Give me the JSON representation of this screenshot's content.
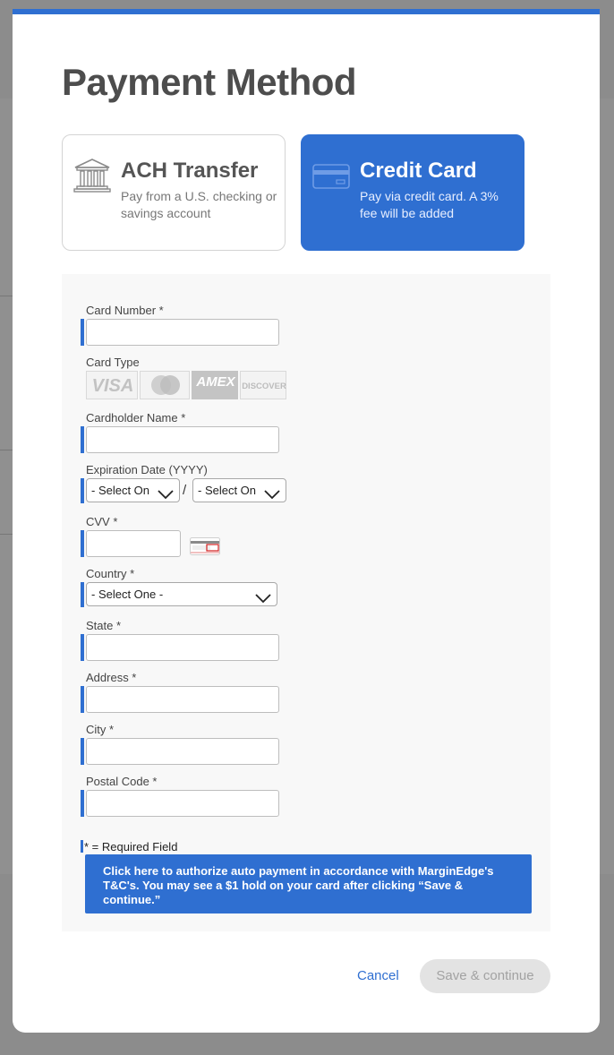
{
  "modal": {
    "title": "Payment Method"
  },
  "methods": {
    "ach": {
      "title": "ACH Transfer",
      "description": "Pay from a U.S. checking or savings account",
      "icon": "bank-icon"
    },
    "credit_card": {
      "title": "Credit Card",
      "description": "Pay via credit card. A 3% fee will be added",
      "icon": "credit-card-icon",
      "selected": true
    }
  },
  "form": {
    "card_number_label": "Card Number *",
    "card_number_value": "",
    "card_type_label": "Card Type",
    "card_types": [
      "VISA",
      "Mastercard",
      "AMEX",
      "DISCOVER"
    ],
    "cardholder_label": "Cardholder Name *",
    "cardholder_value": "",
    "expiration_label": "Expiration Date (YYYY)",
    "exp_month_value": "- Select On",
    "exp_separator": "/",
    "exp_year_value": "- Select On",
    "cvv_label": "CVV *",
    "cvv_value": "",
    "country_label": "Country *",
    "country_value": "- Select One -",
    "state_label": "State *",
    "state_value": "",
    "address_label": "Address *",
    "address_value": "",
    "city_label": "City *",
    "city_value": "",
    "postal_label": "Postal Code *",
    "postal_value": "",
    "required_note": "* = Required Field",
    "authorize_text": "Click here to authorize auto payment in accordance with MarginEdge's T&C's. You may see a $1 hold on your card after clicking “Save & continue.”"
  },
  "footer": {
    "cancel_label": "Cancel",
    "save_label": "Save & continue"
  },
  "colors": {
    "accent": "#2f6fd1",
    "title": "#4d4d4d",
    "disabled_bg": "#e3e3e3",
    "disabled_text": "#a2a2a2"
  }
}
